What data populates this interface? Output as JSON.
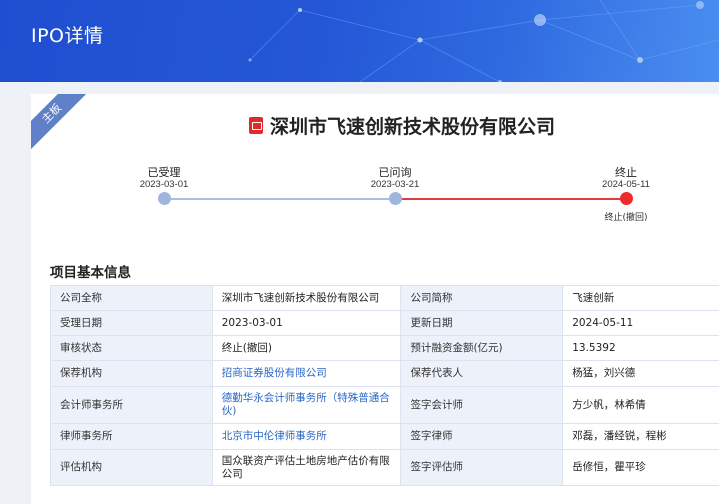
{
  "header": {
    "title": "IPO详情"
  },
  "board_badge": "主板",
  "company": {
    "name": "深圳市飞速创新技术股份有限公司"
  },
  "timeline": [
    {
      "label": "已受理",
      "date": "2023-03-01",
      "status": "done"
    },
    {
      "label": "已问询",
      "date": "2023-03-21",
      "status": "done"
    },
    {
      "label": "终止",
      "date": "2024-05-11",
      "status": "terminated",
      "sub": "终止(撤回)"
    }
  ],
  "section": {
    "title": "项目基本信息"
  },
  "rows": [
    {
      "k1": "公司全称",
      "v1": "深圳市飞速创新技术股份有限公司",
      "k2": "公司简称",
      "v2": "飞速创新"
    },
    {
      "k1": "受理日期",
      "v1": "2023-03-01",
      "k2": "更新日期",
      "v2": "2024-05-11"
    },
    {
      "k1": "审核状态",
      "v1": "终止(撤回)",
      "k2": "预计融资金额(亿元)",
      "v2": "13.5392"
    },
    {
      "k1": "保荐机构",
      "v1": "招商证券股份有限公司",
      "k2": "保荐代表人",
      "v2": "杨猛，刘兴德"
    },
    {
      "k1": "会计师事务所",
      "v1": "德勤华永会计师事务所（特殊普通合伙)",
      "k2": "签字会计师",
      "v2": "方少帆，林希倩"
    },
    {
      "k1": "律师事务所",
      "v1": "北京市中伦律师事务所",
      "k2": "签字律师",
      "v2": "邓磊，潘经锐，程彬"
    },
    {
      "k1": "评估机构",
      "v1": "国众联资产评估土地房地产估价有限公司",
      "k2": "签字评估师",
      "v2": "岳修恒，瞿平珍"
    }
  ],
  "colors": {
    "accent": "#2457d6",
    "link": "#2a67c7",
    "terminated": "#ee2b2b",
    "done": "#9fb6dc"
  }
}
